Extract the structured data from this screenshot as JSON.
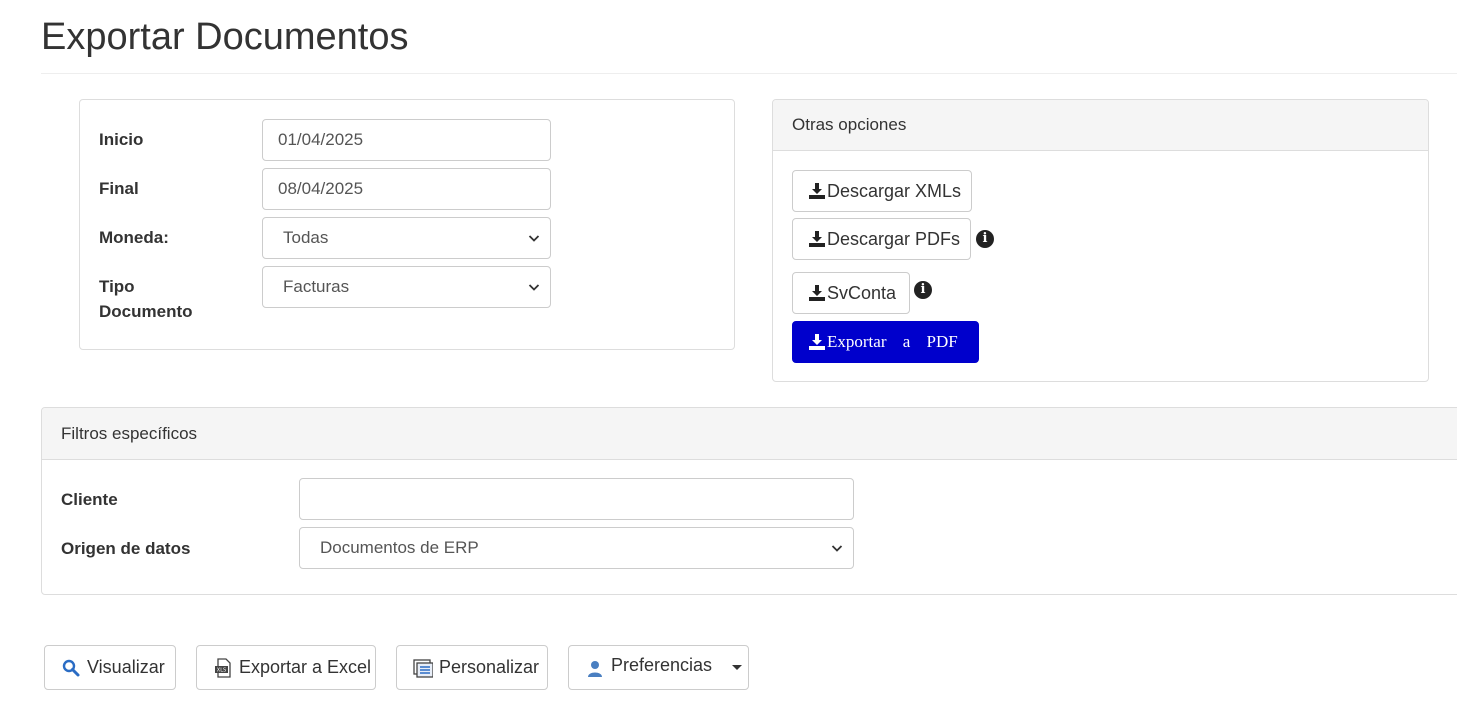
{
  "page": {
    "title": "Exportar Documentos"
  },
  "main_form": {
    "start_label": "Inicio",
    "start_value": "01/04/2025",
    "end_label": "Final",
    "end_value": "08/04/2025",
    "currency_label": "Moneda:",
    "currency_value": "Todas",
    "doctype_label_line1": "Tipo",
    "doctype_label_line2": "Documento",
    "doctype_value": "Facturas"
  },
  "other_options": {
    "heading": "Otras opciones",
    "download_xmls": "Descargar XMLs",
    "download_pdfs": "Descargar PDFs",
    "svconta": "SvConta",
    "export_pdf": "Exportar a PDF",
    "info_glyph": "i"
  },
  "filters": {
    "heading": "Filtros específicos",
    "client_label": "Cliente",
    "client_value": "",
    "source_label": "Origen de datos",
    "source_value": "Documentos de ERP"
  },
  "toolbar": {
    "view_label": "Visualizar",
    "excel_label": "Exportar a Excel",
    "customize_label": "Personalizar",
    "preferences_label": "Preferencias"
  },
  "colors": {
    "primary": "#0000cc",
    "panel_heading_bg": "#f5f5f5",
    "border": "#dddddd"
  }
}
